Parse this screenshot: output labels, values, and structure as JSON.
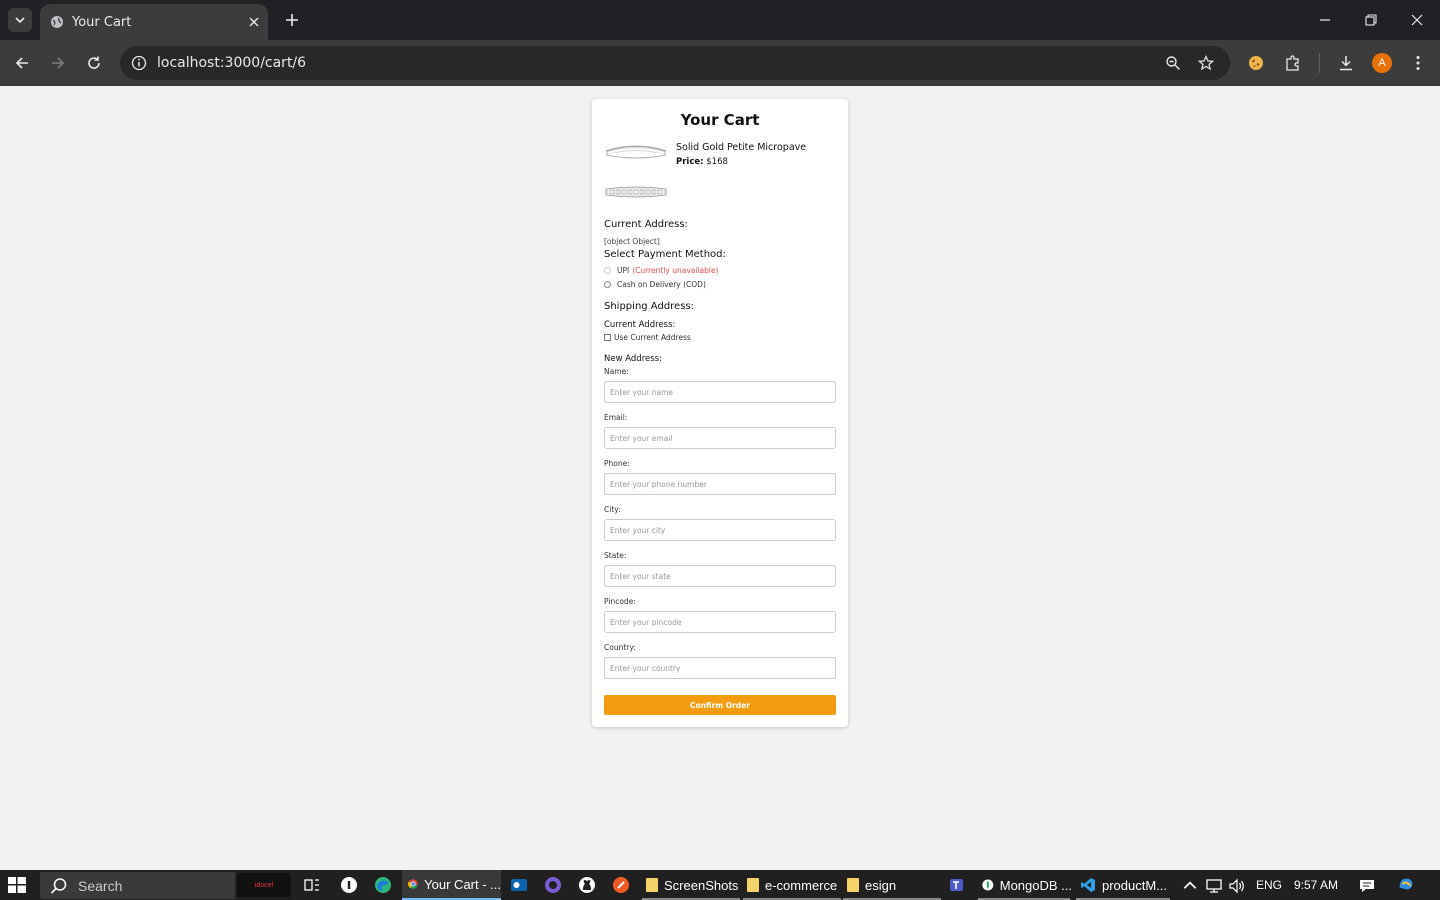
{
  "browser": {
    "tab_title": "Your Cart",
    "url": "localhost:3000/cart/6",
    "profile_initial": "A"
  },
  "cart": {
    "title": "Your Cart",
    "product": {
      "name": "Solid Gold Petite Micropave",
      "price_label": "Price:",
      "price_value": "$168"
    },
    "current_address_heading": "Current Address:",
    "current_address_value": "[object Object]",
    "payment_heading": "Select Payment Method:",
    "payment_options": [
      {
        "label": "UPI",
        "note": "(Currently unavailable)"
      },
      {
        "label": "Cash on Delivery (COD)"
      }
    ],
    "shipping_heading": "Shipping Address:",
    "shipping_current_label": "Current Address:",
    "use_current_label": "Use Current Address",
    "new_address_label": "New Address:",
    "fields": [
      {
        "label": "Name:",
        "placeholder": "Enter your name"
      },
      {
        "label": "Email:",
        "placeholder": "Enter your email"
      },
      {
        "label": "Phone:",
        "placeholder": "Enter your phone number"
      },
      {
        "label": "City:",
        "placeholder": "Enter your city"
      },
      {
        "label": "State:",
        "placeholder": "Enter your state"
      },
      {
        "label": "Pincode:",
        "placeholder": "Enter your pincode"
      },
      {
        "label": "Country:",
        "placeholder": "Enter your country"
      }
    ],
    "confirm_label": "Confirm Order",
    "accent_color": "#f39c12"
  },
  "taskbar": {
    "search_label": "Search",
    "ad_label": "idocel",
    "apps": [
      {
        "label": "Your Cart - ..."
      },
      {
        "label": "ScreenShots"
      },
      {
        "label": "e-commerce"
      },
      {
        "label": "esign"
      },
      {
        "label": "MongoDB ..."
      },
      {
        "label": "productM..."
      }
    ],
    "language": "ENG",
    "time": "9:57 AM"
  }
}
